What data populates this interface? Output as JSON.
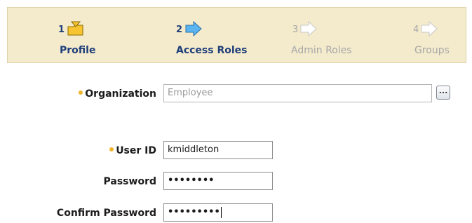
{
  "wizard": {
    "steps": [
      {
        "number": "1",
        "label": "Profile",
        "state": "current",
        "icon": "folder-arrow-icon"
      },
      {
        "number": "2",
        "label": "Access Roles",
        "state": "active",
        "icon": "arrow-right-icon"
      },
      {
        "number": "3",
        "label": "Admin Roles",
        "state": "inactive",
        "icon": "arrow-right-icon"
      },
      {
        "number": "4",
        "label": "Groups",
        "state": "inactive",
        "icon": "arrow-right-icon"
      }
    ]
  },
  "form": {
    "organization": {
      "label": "Organization",
      "value": "Employee",
      "required": true
    },
    "lookup_button": {
      "label": "..."
    },
    "user_id": {
      "label": "User ID",
      "value": "kmiddleton",
      "required": true
    },
    "password": {
      "label": "Password",
      "value": "••••••••"
    },
    "confirm_password": {
      "label": "Confirm Password",
      "value": "•••••••••"
    }
  },
  "colors": {
    "wizard_bg": "#f4ebcd",
    "active_text": "#1f3f7a",
    "inactive_text": "#a7a7a7",
    "required_dot": "#f0b429",
    "arrow_blue": "#5ab4ef",
    "folder_yellow": "#f7c531"
  }
}
